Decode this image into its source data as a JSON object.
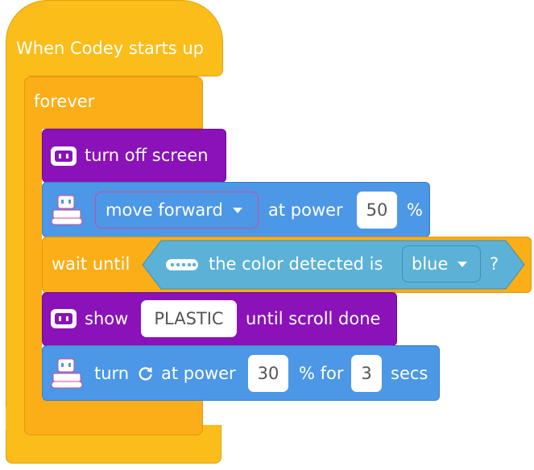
{
  "hat": {
    "label": "When Codey starts up"
  },
  "forever": {
    "label": "forever"
  },
  "turn_off_screen": {
    "label": "turn off screen"
  },
  "move": {
    "direction": "move forward",
    "at_power": "at power",
    "power": "50",
    "percent": "%"
  },
  "wait_until": {
    "label": "wait until",
    "sensor_label": "the color detected is",
    "color": "blue",
    "question": "?"
  },
  "show": {
    "label": "show",
    "text": "PLASTIC",
    "suffix": "until scroll done"
  },
  "turn": {
    "label": "turn",
    "at_power": "at power",
    "power": "30",
    "percent_for": "% for",
    "secs_value": "3",
    "secs": "secs"
  },
  "colors": {
    "events": "#fbbd19",
    "control": "#fbae18",
    "looks": "#8a12b8",
    "motion": "#4c97e6",
    "sensing": "#5cb1d6"
  },
  "icons": {
    "screen": "codey-screen-icon",
    "robot": "codey-robot-icon",
    "sensor": "color-sensor-icon",
    "rotate": "rotate-clockwise-icon",
    "dropdown": "chevron-down-icon"
  }
}
